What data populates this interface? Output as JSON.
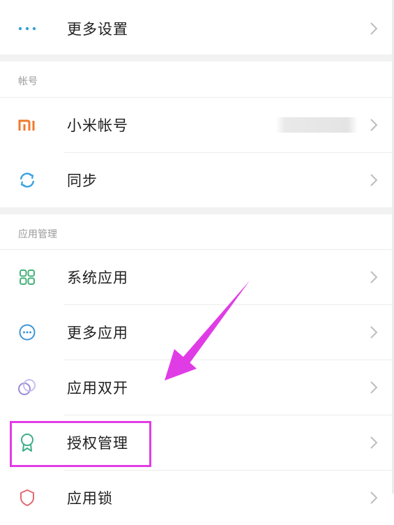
{
  "rows": {
    "more_settings": {
      "label": "更多设置",
      "icon": "more-dots-icon"
    },
    "mi_account": {
      "label": "小米帐号",
      "icon": "mi-logo-icon"
    },
    "sync": {
      "label": "同步",
      "icon": "sync-icon"
    },
    "system_apps": {
      "label": "系统应用",
      "icon": "grid-icon"
    },
    "more_apps": {
      "label": "更多应用",
      "icon": "more-circle-icon"
    },
    "dual_apps": {
      "label": "应用双开",
      "icon": "dual-circle-icon"
    },
    "permissions": {
      "label": "授权管理",
      "icon": "badge-icon"
    },
    "app_lock": {
      "label": "应用锁",
      "icon": "shield-icon"
    }
  },
  "sections": {
    "account": {
      "title": "帐号"
    },
    "app_management": {
      "title": "应用管理"
    }
  },
  "colors": {
    "accent_blue": "#34a1d8",
    "mi_orange": "#f07a2a",
    "sync_blue": "#3da2e0",
    "grid_green": "#47b17a",
    "more_apps_blue": "#3e96d6",
    "dual_purple": "#9a8bd6",
    "badge_green": "#3fae86",
    "shield_red": "#e06a72",
    "highlight_magenta": "#e23ce6",
    "arrow_magenta": "#e03ce6"
  }
}
